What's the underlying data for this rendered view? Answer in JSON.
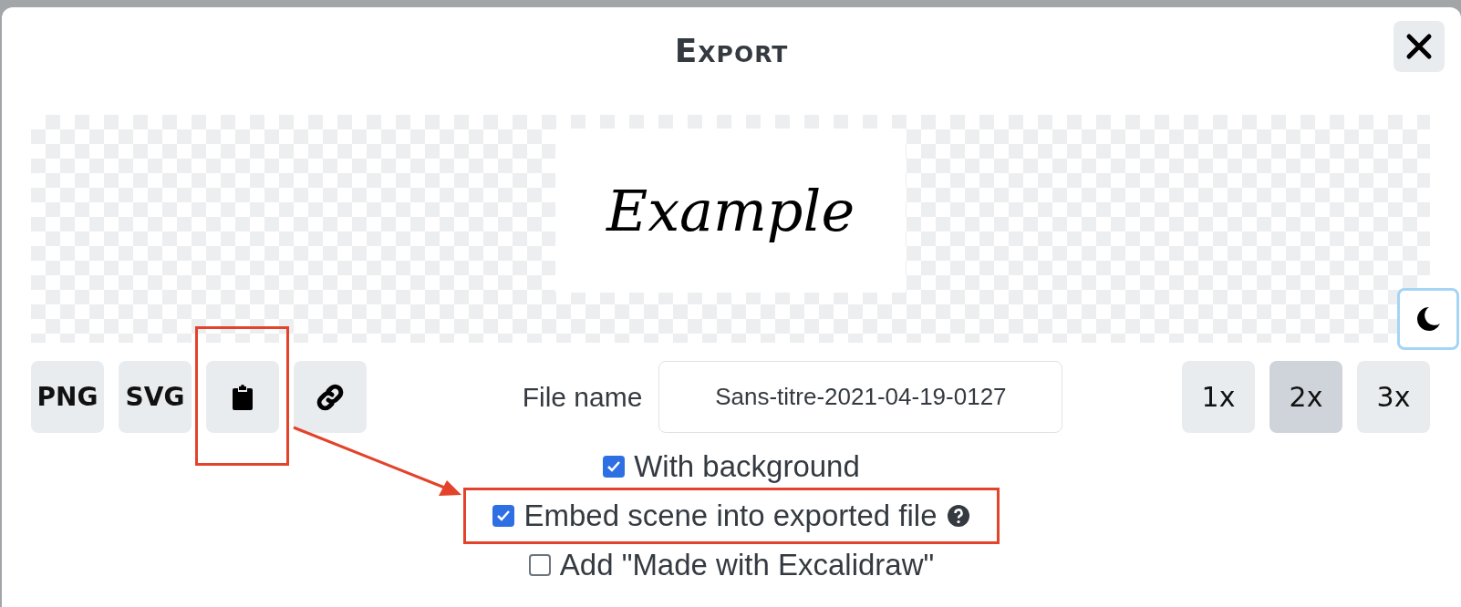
{
  "dialog": {
    "title": "Export"
  },
  "preview": {
    "text": "Example"
  },
  "format_buttons": [
    {
      "kind": "text",
      "label": "PNG",
      "highlighted": false
    },
    {
      "kind": "text",
      "label": "SVG",
      "highlighted": false
    },
    {
      "kind": "clipboard",
      "highlighted": true
    },
    {
      "kind": "link",
      "highlighted": false
    }
  ],
  "file_name": {
    "label": "File name",
    "value": "Sans-titre-2021-04-19-0127"
  },
  "scale_buttons": [
    {
      "label": "1x",
      "selected": false
    },
    {
      "label": "2x",
      "selected": true
    },
    {
      "label": "3x",
      "selected": false
    }
  ],
  "options": [
    {
      "label": "With background",
      "checked": true,
      "help": false,
      "highlighted": false
    },
    {
      "label": "Embed scene into exported file",
      "checked": true,
      "help": true,
      "highlighted": true
    },
    {
      "label": "Add \"Made with Excalidraw\"",
      "checked": false,
      "help": false,
      "highlighted": false
    }
  ]
}
